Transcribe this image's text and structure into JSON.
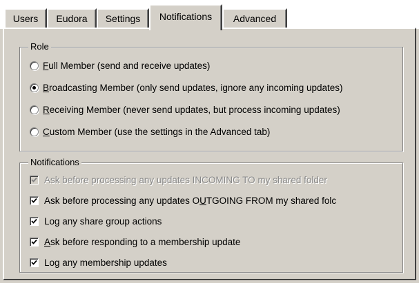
{
  "tabs": [
    {
      "label": "Users",
      "active": false
    },
    {
      "label": "Eudora",
      "active": false
    },
    {
      "label": "Settings",
      "active": false
    },
    {
      "label": "Notifications",
      "active": true
    },
    {
      "label": "Advanced",
      "active": false
    }
  ],
  "role": {
    "title": "Role",
    "options": [
      {
        "accel": "F",
        "rest": "ull Member (send and receive updates)",
        "selected": false
      },
      {
        "accel": "B",
        "rest": "roadcasting Member (only send updates, ignore any incoming updates)",
        "selected": true
      },
      {
        "accel": "R",
        "rest": "eceiving Member (never send updates, but process incoming updates)",
        "selected": false
      },
      {
        "accel": "C",
        "rest": "ustom Member (use the settings in the Advanced tab)",
        "selected": false
      }
    ]
  },
  "notifications": {
    "title": "Notifications",
    "items": [
      {
        "label": "Ask before processing any updates INCOMING TO my shared folder",
        "checked": true,
        "enabled": false
      },
      {
        "label_before": "Ask before processing any updates O",
        "accel": "U",
        "label_after": "TGOING FROM my shared folc",
        "checked": true,
        "enabled": true
      },
      {
        "label": "Log any share group actions",
        "checked": true,
        "enabled": true
      },
      {
        "accel": "A",
        "label_after": "sk before responding to a membership update",
        "checked": true,
        "enabled": true
      },
      {
        "label": "Log any membership updates",
        "checked": true,
        "enabled": true
      }
    ]
  },
  "colors": {
    "face": "#d4d0c8",
    "highlight": "#ffffff",
    "shadow": "#808080",
    "disabled_text": "#8a8a8a"
  }
}
